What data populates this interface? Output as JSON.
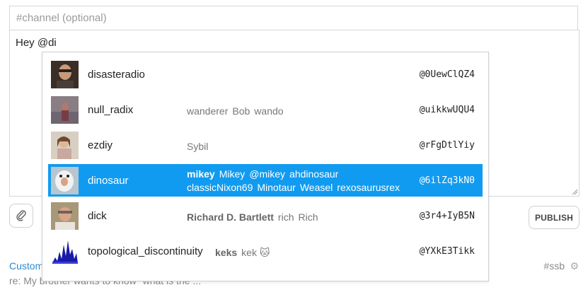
{
  "composer": {
    "channel_placeholder": "#channel (optional)",
    "channel_value": "",
    "text": "Hey @di",
    "publish_label": "PUBLISH"
  },
  "feed": {
    "author_partial": "Custom",
    "channel": "#ssb",
    "preview": "re: My brother wants to know \"what is the ..."
  },
  "suggestions": [
    {
      "username": "disasteradio",
      "names": [],
      "id": "@0UewClQZ4",
      "selected": false
    },
    {
      "username": "null_radix",
      "names": [
        "wanderer",
        "Bob",
        "wando"
      ],
      "id": "@uikkwUQU4",
      "selected": false
    },
    {
      "username": "ezdiy",
      "names": [
        "Sybil"
      ],
      "id": "@rFgDtlYiy",
      "selected": false
    },
    {
      "username": "dinosaur",
      "names_primary": "mikey",
      "names": [
        "Mikey",
        "@mikey",
        "ahdinosaur",
        "classicNixon69",
        "Minotaur",
        "Weasel",
        "rexosaurusrex"
      ],
      "id": "@6ilZq3kN0",
      "selected": true
    },
    {
      "username": "dick",
      "names_primary": "Richard D. Bartlett",
      "names": [
        "rich",
        "Rich"
      ],
      "id": "@3r4+IyB5N",
      "selected": false
    },
    {
      "username": "topological_discontinuity",
      "names_primary": "keks",
      "names": [
        "kek 🐱"
      ],
      "id": "@YXkE3Tikk",
      "selected": false
    }
  ],
  "colors": {
    "selected_row": "#119bf0",
    "link": "#2a8ad4"
  }
}
